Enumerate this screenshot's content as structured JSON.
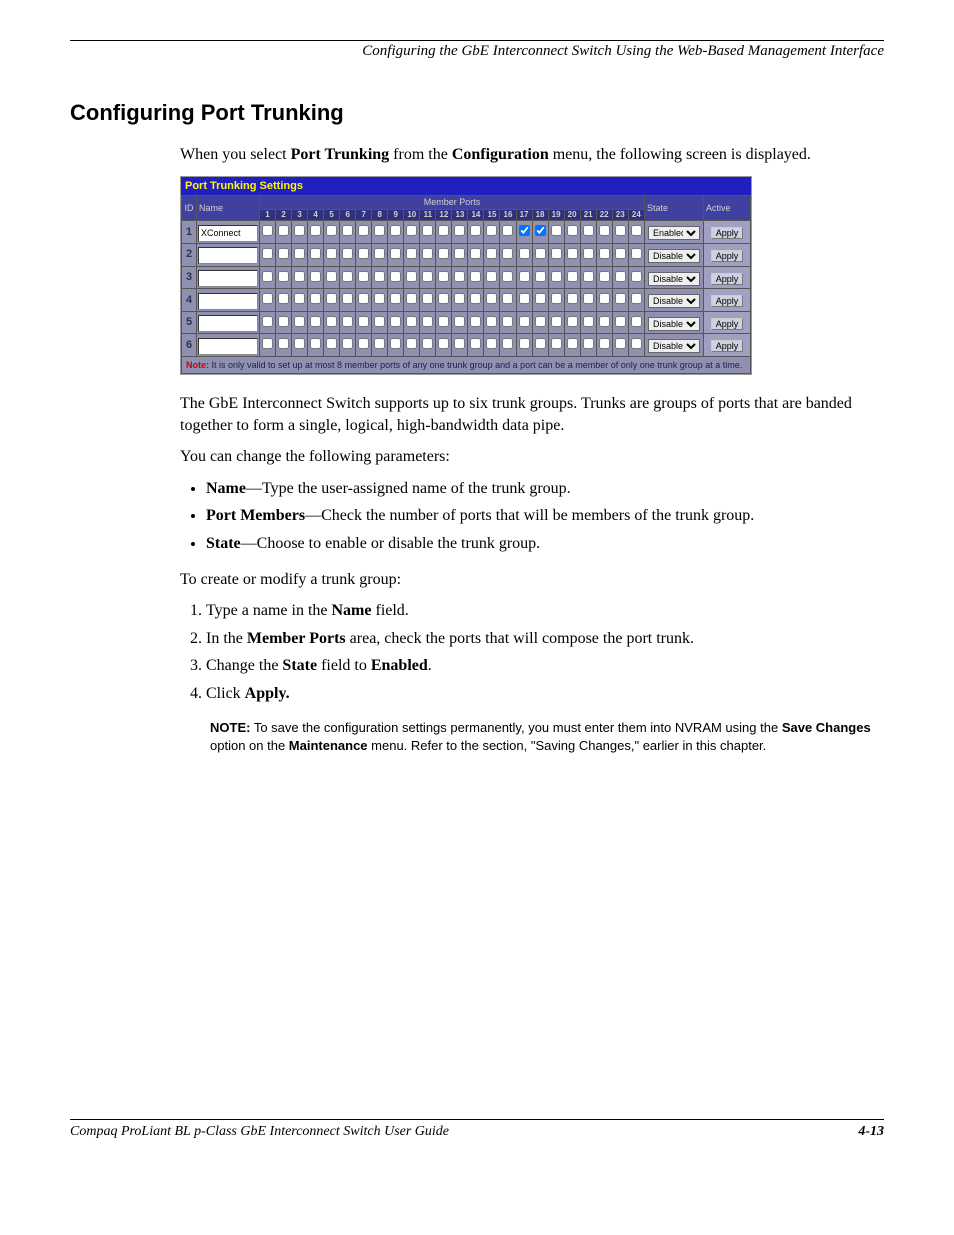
{
  "header": {
    "running": "Configuring the GbE Interconnect Switch Using the Web-Based Management Interface"
  },
  "title": "Configuring Port Trunking",
  "intro": {
    "p1a": "When you select ",
    "p1b": "Port Trunking",
    "p1c": " from the ",
    "p1d": "Configuration",
    "p1e": " menu, the following screen is displayed."
  },
  "screenshot": {
    "title": "Port Trunking Settings",
    "cols": {
      "id": "ID",
      "name": "Name",
      "member": "Member Ports",
      "state": "State",
      "active": "Active"
    },
    "portHeaders": [
      "1",
      "2",
      "3",
      "4",
      "5",
      "6",
      "7",
      "8",
      "9",
      "10",
      "11",
      "12",
      "13",
      "14",
      "15",
      "16",
      "17",
      "18",
      "19",
      "20",
      "21",
      "22",
      "23",
      "24"
    ],
    "rows": [
      {
        "id": "1",
        "name": "XConnect",
        "checks": [
          false,
          false,
          false,
          false,
          false,
          false,
          false,
          false,
          false,
          false,
          false,
          false,
          false,
          false,
          false,
          false,
          true,
          true,
          false,
          false,
          false,
          false,
          false,
          false
        ],
        "state": "Enabled"
      },
      {
        "id": "2",
        "name": "",
        "checks": [
          false,
          false,
          false,
          false,
          false,
          false,
          false,
          false,
          false,
          false,
          false,
          false,
          false,
          false,
          false,
          false,
          false,
          false,
          false,
          false,
          false,
          false,
          false,
          false
        ],
        "state": "Disabled"
      },
      {
        "id": "3",
        "name": "",
        "checks": [
          false,
          false,
          false,
          false,
          false,
          false,
          false,
          false,
          false,
          false,
          false,
          false,
          false,
          false,
          false,
          false,
          false,
          false,
          false,
          false,
          false,
          false,
          false,
          false
        ],
        "state": "Disabled"
      },
      {
        "id": "4",
        "name": "",
        "checks": [
          false,
          false,
          false,
          false,
          false,
          false,
          false,
          false,
          false,
          false,
          false,
          false,
          false,
          false,
          false,
          false,
          false,
          false,
          false,
          false,
          false,
          false,
          false,
          false
        ],
        "state": "Disabled"
      },
      {
        "id": "5",
        "name": "",
        "checks": [
          false,
          false,
          false,
          false,
          false,
          false,
          false,
          false,
          false,
          false,
          false,
          false,
          false,
          false,
          false,
          false,
          false,
          false,
          false,
          false,
          false,
          false,
          false,
          false
        ],
        "state": "Disabled"
      },
      {
        "id": "6",
        "name": "",
        "checks": [
          false,
          false,
          false,
          false,
          false,
          false,
          false,
          false,
          false,
          false,
          false,
          false,
          false,
          false,
          false,
          false,
          false,
          false,
          false,
          false,
          false,
          false,
          false,
          false
        ],
        "state": "Disabled"
      }
    ],
    "applyLabel": "Apply",
    "stateOptions": [
      "Enabled",
      "Disabled"
    ],
    "noteLabel": "Note:",
    "noteText": " It is only valid to set up at most 8 member ports of any one trunk group and a port can be a member of only one trunk group at a time."
  },
  "para2": "The GbE Interconnect Switch supports up to six trunk groups. Trunks are groups of ports that are banded together to form a single, logical, high-bandwidth data pipe.",
  "para3": "You can change the following parameters:",
  "bullets": [
    {
      "label": "Name",
      "text": "—Type the user-assigned name of the trunk group."
    },
    {
      "label": "Port Members",
      "text": "—Check the number of ports that will be members of the trunk group."
    },
    {
      "label": "State",
      "text": "—Choose to enable or disable the trunk group."
    }
  ],
  "para4": "To create or modify a trunk group:",
  "steps": [
    {
      "pre": "Type a name in the ",
      "bold": "Name",
      "post": " field."
    },
    {
      "pre": "In the ",
      "bold": "Member Ports",
      "post": " area, check the ports that will compose the port trunk."
    },
    {
      "pre": "Change the ",
      "bold": "State",
      "post1": " field to ",
      "bold2": "Enabled",
      "post2": "."
    },
    {
      "pre": "Click ",
      "bold": "Apply.",
      "post": ""
    }
  ],
  "noteBlock": {
    "label": "NOTE:",
    "t1": "  To save the configuration settings permanently, you must enter them into NVRAM using the ",
    "b1": "Save Changes",
    "t2": " option on the ",
    "b2": "Maintenance",
    "t3": " menu. Refer to the section, \"Saving Changes,\" earlier in this chapter."
  },
  "footer": {
    "left": "Compaq ProLiant BL p-Class GbE Interconnect Switch User Guide",
    "right": "4-13"
  }
}
